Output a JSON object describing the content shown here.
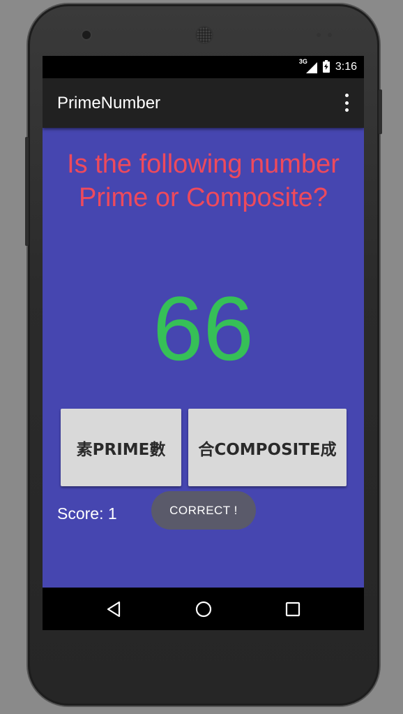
{
  "status_bar": {
    "network": "3G",
    "time": "3:16"
  },
  "toolbar": {
    "title": "PrimeNumber"
  },
  "question": "Is the following number Prime or Composite?",
  "number": "66",
  "buttons": {
    "prime_label": "素PRIME數",
    "composite_label": "合COMPOSITE成"
  },
  "score_label": "Score: 1",
  "toast": "CORRECT !",
  "colors": {
    "background": "#4646b0",
    "question": "#ee4a5c",
    "number": "#36c057",
    "toolbar": "#212121"
  },
  "icons": {
    "overflow": "overflow-menu-icon",
    "back": "back-icon",
    "home": "home-icon",
    "recents": "recents-icon"
  }
}
